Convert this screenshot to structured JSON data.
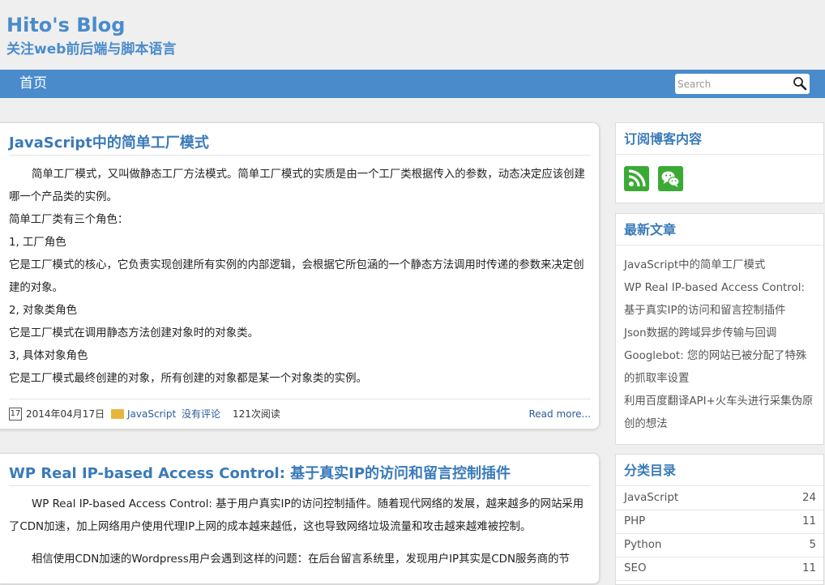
{
  "site": {
    "title": "Hito's Blog",
    "description": "关注web前后端与脚本语言"
  },
  "nav": {
    "home": "首页"
  },
  "search": {
    "placeholder": "Search"
  },
  "posts": [
    {
      "title": "JavaScript中的简单工厂模式",
      "paragraphs": [
        "简单工厂模式，又叫做静态工厂方法模式。简单工厂模式的实质是由一个工厂类根据传入的参数，动态决定应该创建哪一个产品类的实例。",
        "简单工厂类有三个角色：",
        "1, 工厂角色",
        "它是工厂模式的核心，它负责实现创建所有实例的内部逻辑，会根据它所包涵的一个静态方法调用时传递的参数来决定创建的对象。",
        "2, 对象类角色",
        "它是工厂模式在调用静态方法创建对象时的对象类。",
        "3, 具体对象角色",
        "它是工厂模式最终创建的对象，所有创建的对象都是某一个对象类的实例。"
      ],
      "meta": {
        "calendar_day": "17",
        "date": "2014年04月17日",
        "category": "JavaScript",
        "comments": "没有评论",
        "views": "121次阅读",
        "read_more": "Read more..."
      }
    },
    {
      "title": "WP Real IP-based Access Control: 基于真实IP的访问和留言控制插件",
      "paragraphs": [
        "WP Real IP-based Access Control: 基于用户真实IP的访问控制插件。随着现代网络的发展，越来越多的网站采用了CDN加速，加上网络用户使用代理IP上网的成本越来越低，这也导致网络垃圾流量和攻击越来越难被控制。",
        "相信使用CDN加速的Wordpress用户会遇到这样的问题：在后台留言系统里，发现用户IP其实是CDN服务商的节"
      ]
    }
  ],
  "sidebar": {
    "subscribe": {
      "title": "订阅博客内容",
      "icons": [
        "rss-icon",
        "wechat-icon"
      ],
      "icon_color": "#3aaa35"
    },
    "recent": {
      "title": "最新文章",
      "items": [
        "JavaScript中的简单工厂模式",
        "WP Real IP-based Access Control: 基于真实IP的访问和留言控制插件",
        "Json数据的跨域异步传输与回调",
        "Googlebot: 您的网站已被分配了特殊的抓取率设置",
        "利用百度翻译API+火车头进行采集伪原创的想法"
      ]
    },
    "categories": {
      "title": "分类目录",
      "items": [
        {
          "name": "JavaScript",
          "count": "24"
        },
        {
          "name": "PHP",
          "count": "11"
        },
        {
          "name": "Python",
          "count": "5"
        },
        {
          "name": "SEO",
          "count": "11"
        }
      ]
    }
  },
  "colors": {
    "accent": "#4a8ccb",
    "title_blue": "#3a7ab8",
    "background": "#efefef"
  }
}
